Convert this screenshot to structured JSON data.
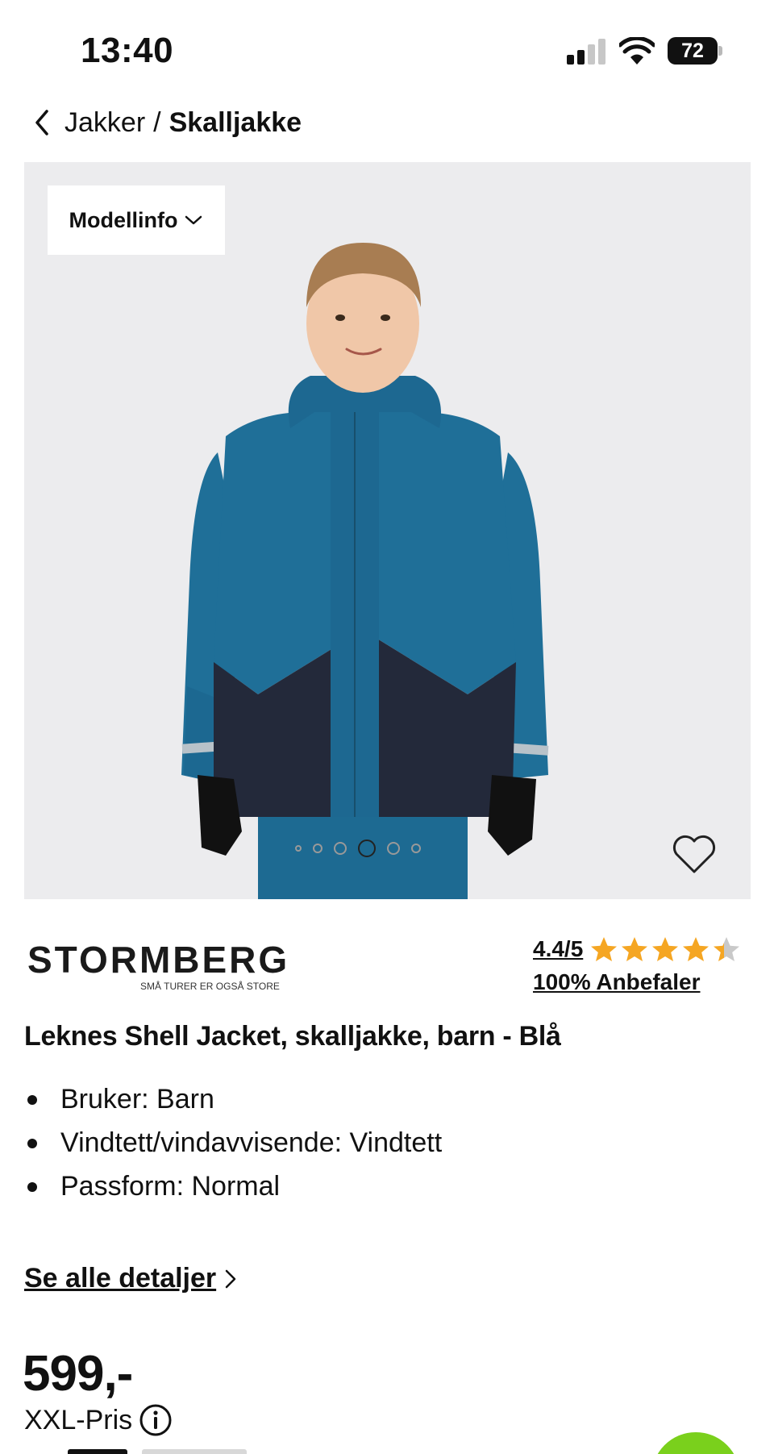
{
  "status_bar": {
    "time": "13:40",
    "battery": "72",
    "icons": [
      "cellular-signal-icon",
      "wifi-icon",
      "battery-icon"
    ]
  },
  "breadcrumb": {
    "back_icon": "chevron-left-icon",
    "parent": "Jakker",
    "separator": "/",
    "current": "Skalljakke"
  },
  "gallery": {
    "model_info_label": "Modellinfo",
    "model_info_icon": "chevron-down-icon",
    "image_count": 6,
    "active_index": 3,
    "favorite_icon": "heart-outline-icon",
    "background_color": "#ececee"
  },
  "brand": {
    "name": "STORMBERG",
    "tagline": "SMÅ TURER ER OGSÅ STORE"
  },
  "rating": {
    "score": "4.4/5",
    "value": 4.4,
    "max": 5,
    "recommend": "100% Anbefaler",
    "star_color": "#f5a623"
  },
  "product": {
    "title": "Leknes Shell Jacket, skalljakke, barn - Blå",
    "features": [
      "Bruker: Barn",
      "Vindtett/vindavvisende: Vindtett",
      "Passform: Normal"
    ],
    "details_link": "Se alle detaljer"
  },
  "price": {
    "amount": "599,-",
    "label": "XXL-Pris",
    "info_icon": "info-circle-icon"
  },
  "colors": {
    "jacket_blue": "#1f6f98",
    "jacket_navy": "#23293a",
    "accent_green": "#7ad01c"
  }
}
